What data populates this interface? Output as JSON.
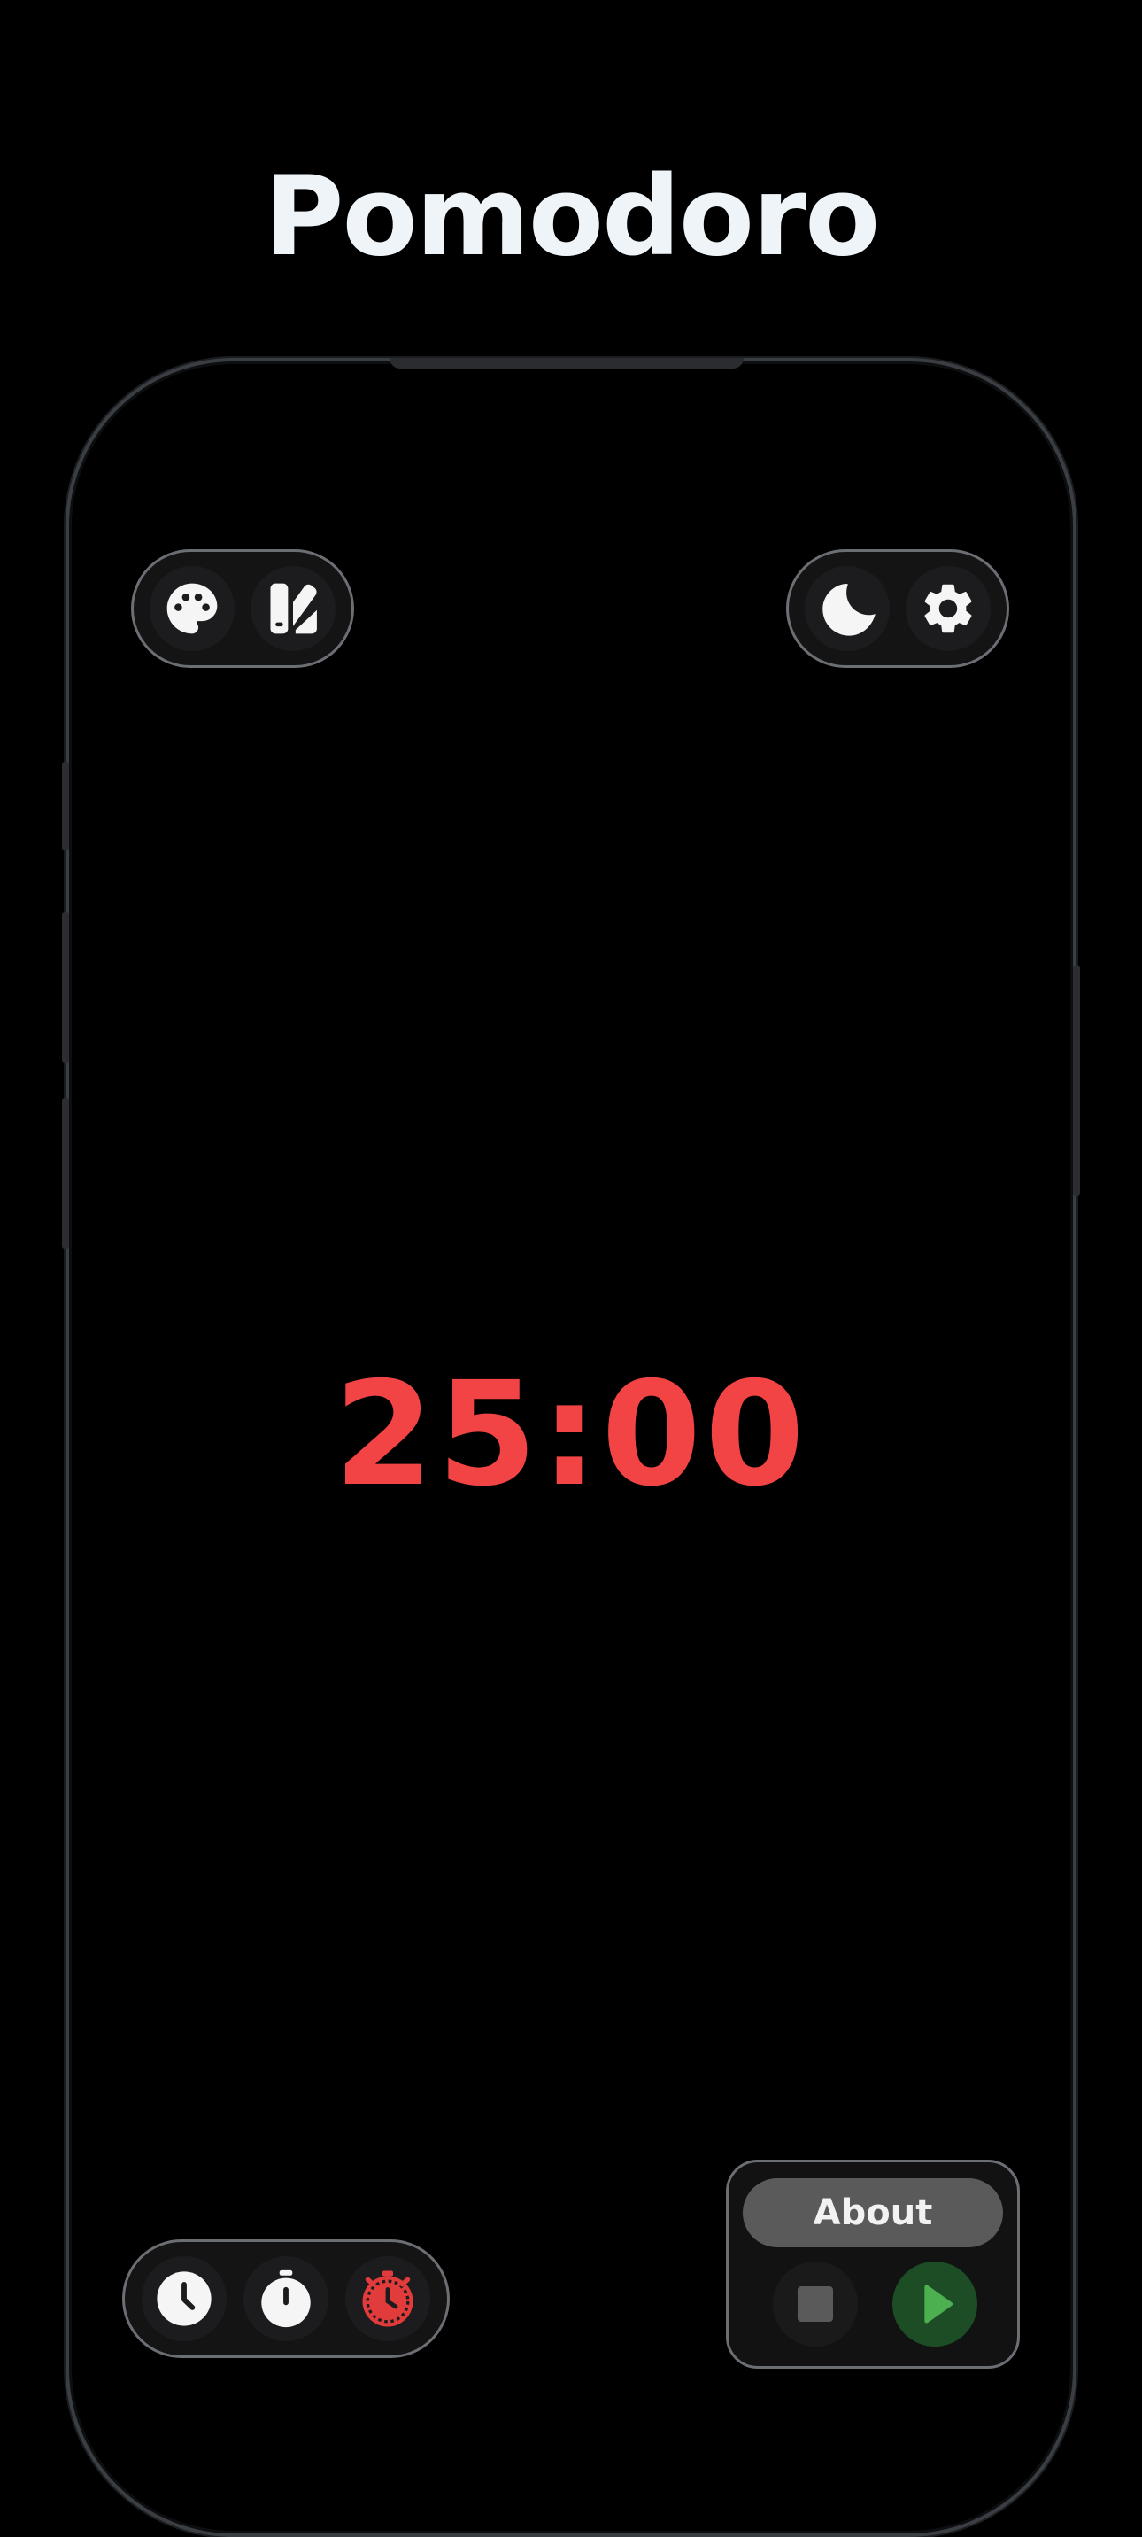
{
  "app": {
    "title": "Pomodoro"
  },
  "toolbar_left": {
    "buttons": [
      {
        "icon": "palette-icon"
      },
      {
        "icon": "swatch-icon"
      }
    ]
  },
  "toolbar_right": {
    "buttons": [
      {
        "icon": "moon-icon"
      },
      {
        "icon": "gear-icon"
      }
    ]
  },
  "timer": {
    "display": "25:00",
    "color": "#f24444"
  },
  "mode_selector": {
    "buttons": [
      {
        "icon": "clock-icon",
        "active": false
      },
      {
        "icon": "stopwatch-icon",
        "active": false
      },
      {
        "icon": "pomodoro-timer-icon",
        "active": true
      }
    ],
    "active_color": "#e23b3b"
  },
  "controls": {
    "about_label": "About",
    "stop_icon": "stop-icon",
    "play_icon": "play-icon",
    "play_color": "#4caf50"
  }
}
